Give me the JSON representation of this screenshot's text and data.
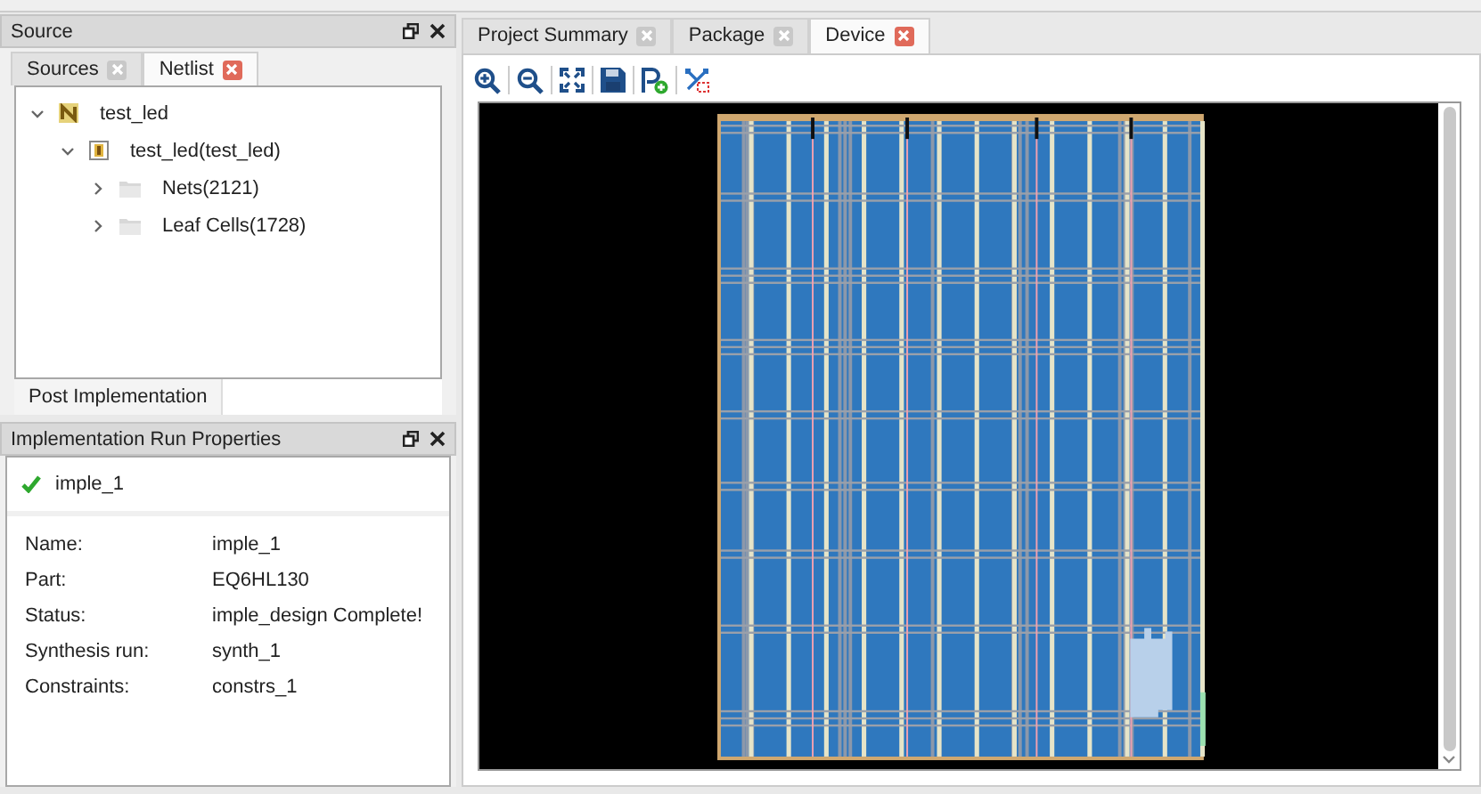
{
  "source_panel": {
    "title": "Source",
    "tabs": [
      {
        "label": "Sources",
        "selected": false
      },
      {
        "label": "Netlist",
        "selected": true
      }
    ],
    "tree": [
      {
        "label": "test_led",
        "kind": "netlist",
        "expanded": true,
        "children": [
          {
            "label": "test_led(test_led)",
            "kind": "module",
            "expanded": true,
            "children": [
              {
                "label": "Nets(2121)",
                "kind": "folder",
                "expanded": false
              },
              {
                "label": "Leaf Cells(1728)",
                "kind": "folder",
                "expanded": false
              }
            ]
          }
        ]
      }
    ],
    "bottom_tabs": [
      {
        "label": "Post Implementation",
        "selected": true
      }
    ]
  },
  "properties_panel": {
    "title": "Implementation Run Properties",
    "run": {
      "name": "imple_1",
      "complete": true
    },
    "properties": [
      {
        "label": "Name:",
        "value": "imple_1"
      },
      {
        "label": "Part:",
        "value": "EQ6HL130"
      },
      {
        "label": "Status:",
        "value": "imple_design Complete!"
      },
      {
        "label": "Synthesis run:",
        "value": "synth_1"
      },
      {
        "label": "Constraints:",
        "value": "constrs_1"
      }
    ]
  },
  "editor": {
    "tabs": [
      {
        "label": "Project Summary",
        "selected": false
      },
      {
        "label": "Package",
        "selected": false
      },
      {
        "label": "Device",
        "selected": true
      }
    ],
    "toolbar": [
      {
        "kind": "zoom-in"
      },
      {
        "kind": "zoom-out"
      },
      {
        "kind": "fit"
      },
      {
        "kind": "save"
      },
      {
        "kind": "add-pblock"
      },
      {
        "kind": "route"
      }
    ]
  }
}
